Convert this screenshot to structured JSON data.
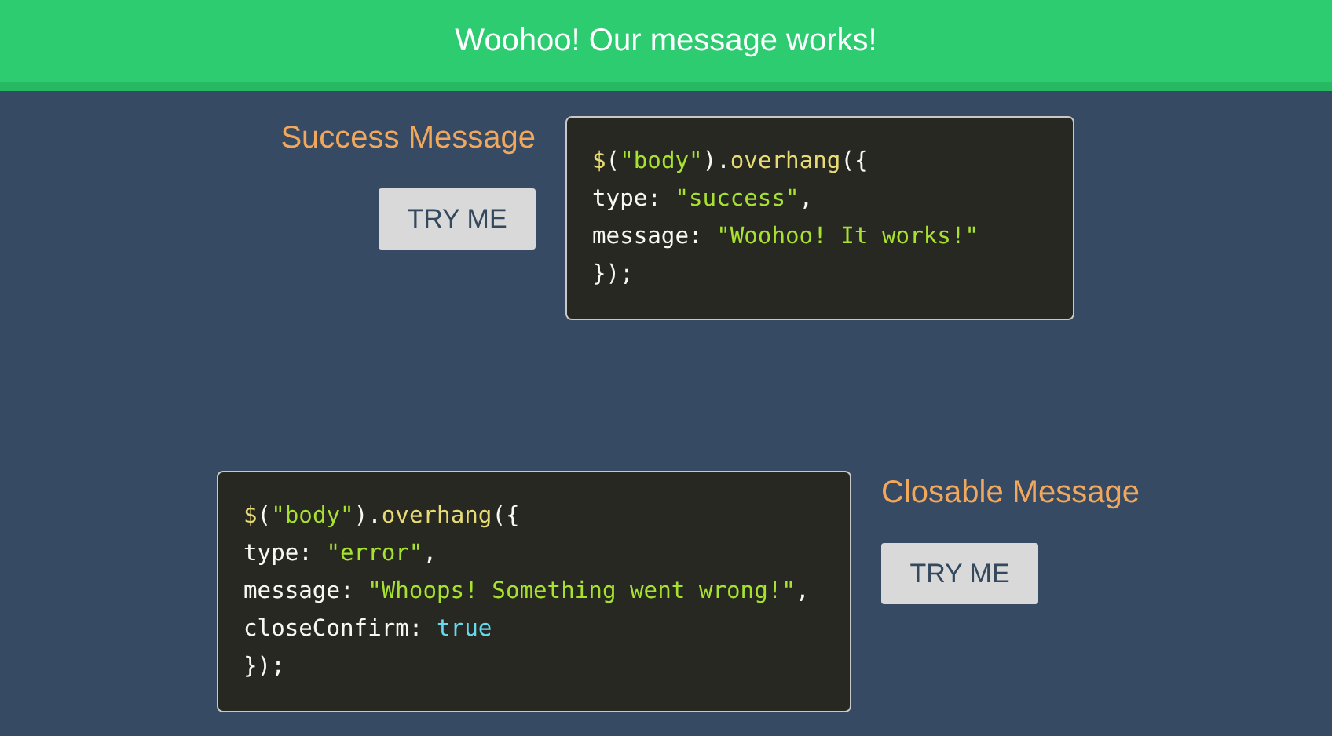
{
  "banner": {
    "message": "Woohoo! Our message works!"
  },
  "sections": [
    {
      "code_first": false,
      "title": "Success Message",
      "button": "TRY ME",
      "code": [
        [
          {
            "kind": "func",
            "text": "$"
          },
          {
            "kind": "plain",
            "text": "("
          },
          {
            "kind": "string",
            "text": "\"body\""
          },
          {
            "kind": "plain",
            "text": ")."
          },
          {
            "kind": "func",
            "text": "overhang"
          },
          {
            "kind": "plain",
            "text": "({"
          }
        ],
        [
          {
            "kind": "plain",
            "text": "type: "
          },
          {
            "kind": "string",
            "text": "\"success\""
          },
          {
            "kind": "plain",
            "text": ","
          }
        ],
        [
          {
            "kind": "plain",
            "text": "message: "
          },
          {
            "kind": "string",
            "text": "\"Woohoo! It works!\""
          }
        ],
        [
          {
            "kind": "plain",
            "text": "});"
          }
        ]
      ]
    },
    {
      "code_first": true,
      "title": "Closable Message",
      "button": "TRY ME",
      "code": [
        [
          {
            "kind": "func",
            "text": "$"
          },
          {
            "kind": "plain",
            "text": "("
          },
          {
            "kind": "string",
            "text": "\"body\""
          },
          {
            "kind": "plain",
            "text": ")."
          },
          {
            "kind": "func",
            "text": "overhang"
          },
          {
            "kind": "plain",
            "text": "({"
          }
        ],
        [
          {
            "kind": "plain",
            "text": "type: "
          },
          {
            "kind": "string",
            "text": "\"error\""
          },
          {
            "kind": "plain",
            "text": ","
          }
        ],
        [
          {
            "kind": "plain",
            "text": "message: "
          },
          {
            "kind": "string",
            "text": "\"Whoops! Something went wrong!\""
          },
          {
            "kind": "plain",
            "text": ","
          }
        ],
        [
          {
            "kind": "plain",
            "text": "closeConfirm: "
          },
          {
            "kind": "bool",
            "text": "true"
          }
        ],
        [
          {
            "kind": "plain",
            "text": "});"
          }
        ]
      ]
    }
  ]
}
